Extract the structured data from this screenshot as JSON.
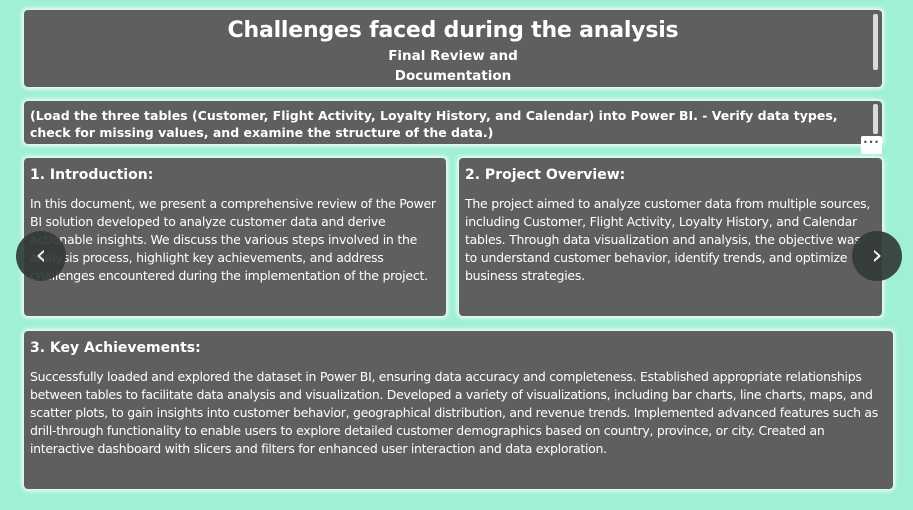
{
  "title_card": {
    "title": "Challenges faced during the analysis",
    "subtitle_line1": "Final Review and",
    "subtitle_line2": "Documentation"
  },
  "load_card": {
    "text": "(Load the three tables (Customer, Flight Activity, Loyalty History, and Calendar) into Power BI. - Verify data types, check for missing values, and examine the structure of the data.)"
  },
  "more_options": {
    "label": "···"
  },
  "introduction": {
    "heading": "1. Introduction:",
    "body": "In this document, we present a comprehensive review of the Power BI solution developed to analyze customer data and derive actionable insights. We discuss the various steps involved in the analysis process, highlight key achievements, and address challenges encountered during the implementation of the project."
  },
  "overview": {
    "heading": "2. Project Overview:",
    "body": "The project aimed to analyze customer data from multiple sources, including Customer, Flight Activity, Loyalty History, and Calendar tables. Through data visualization and analysis, the objective was to understand customer behavior, identify trends, and optimize business strategies."
  },
  "achievements": {
    "heading": "3. Key Achievements:",
    "body": "Successfully loaded and explored the dataset in Power BI, ensuring data accuracy and completeness. Established appropriate relationships between tables to facilitate data analysis and visualization. Developed a variety of visualizations, including bar charts, line charts, maps, and scatter plots, to gain insights into customer behavior, geographical distribution, and revenue trends. Implemented advanced features such as drill-through functionality to enable users to explore detailed customer demographics based on country, province, or city. Created an interactive dashboard with slicers and filters for enhanced user interaction and data exploration."
  },
  "navigation": {
    "prev_glyph": "‹",
    "next_glyph": "›"
  },
  "colors": {
    "background": "#9ff0d4",
    "card": "#5f5f5f",
    "nav_button": "#333a3a"
  }
}
